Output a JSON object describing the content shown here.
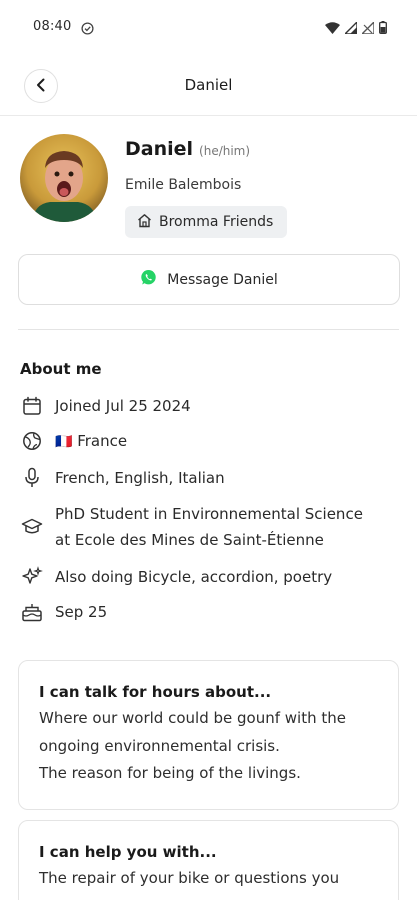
{
  "status_bar": {
    "time": "08:40"
  },
  "header": {
    "title": "Daniel"
  },
  "profile": {
    "name": "Daniel",
    "pronouns": "(he/him)",
    "full_name": "Emile Balembois",
    "group": "Bromma Friends",
    "message_label": "Message Daniel"
  },
  "about": {
    "title": "About me",
    "joined": "Joined Jul 25 2024",
    "country_flag": "🇫🇷",
    "country": "France",
    "languages": "French, English, Italian",
    "education_line1": "PhD Student in Environnemental Science",
    "education_line2": "at Ecole des Mines de Saint-Étienne",
    "hobbies": "Also doing Bicycle, accordion, poetry",
    "birthday": "Sep 25"
  },
  "cards": [
    {
      "title": "I can talk for hours about...",
      "lines": [
        "Where our world could be gounf with the",
        "ongoing environnemental crisis.",
        "The reason for being of the livings."
      ]
    },
    {
      "title": "I can help you with...",
      "lines": [
        "The repair of your bike or questions you"
      ]
    }
  ],
  "colors": {
    "whatsapp_green": "#25D366",
    "divider": "#e4e4e4"
  }
}
